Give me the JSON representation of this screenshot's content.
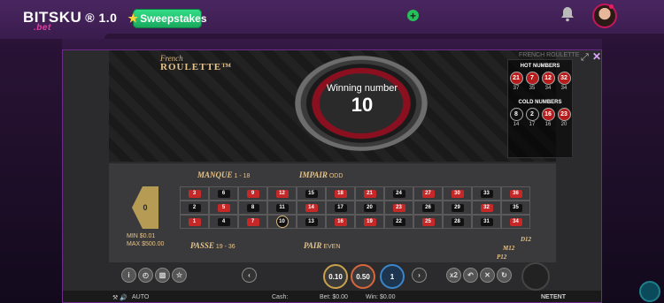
{
  "header": {
    "logo_text": "BITSKU",
    "logo_sub": ".bet",
    "logo_version": "® 1.0",
    "sweep_label": "Sweepstakes"
  },
  "game": {
    "title_line1": "French",
    "title_line2": "ROULETTE™",
    "frame_label": "FRENCH ROULETTE",
    "winning_label": "Winning number",
    "winning_number": "10",
    "hot_label": "HOT NUMBERS",
    "hot": [
      {
        "n": "21",
        "c": "37",
        "color": "red"
      },
      {
        "n": "7",
        "c": "35",
        "color": "red"
      },
      {
        "n": "12",
        "c": "34",
        "color": "red"
      },
      {
        "n": "32",
        "c": "34",
        "color": "red"
      }
    ],
    "cold_label": "COLD NUMBERS",
    "cold": [
      {
        "n": "8",
        "c": "14",
        "color": "black"
      },
      {
        "n": "2",
        "c": "17",
        "color": "black"
      },
      {
        "n": "16",
        "c": "16",
        "color": "red"
      },
      {
        "n": "23",
        "c": "20",
        "color": "red"
      }
    ]
  },
  "table": {
    "manque": "MANQUE",
    "manque_range": "1 - 18",
    "impair": "IMPAIR",
    "impair_sub": "ODD",
    "passe": "PASSE",
    "passe_range": "19 - 36",
    "pair": "PAIR",
    "pair_sub": "EVEN",
    "zero": "0",
    "min": "MIN $0.01",
    "max": "MAX $500.00",
    "d12a": "D12",
    "m12": "M12",
    "p12": "P12",
    "rows": [
      [
        {
          "n": "3",
          "c": "red"
        },
        {
          "n": "6",
          "c": "black"
        },
        {
          "n": "9",
          "c": "red"
        },
        {
          "n": "12",
          "c": "red"
        },
        {
          "n": "15",
          "c": "black"
        },
        {
          "n": "18",
          "c": "red"
        },
        {
          "n": "21",
          "c": "red"
        },
        {
          "n": "24",
          "c": "black"
        },
        {
          "n": "27",
          "c": "red"
        },
        {
          "n": "30",
          "c": "red"
        },
        {
          "n": "33",
          "c": "black"
        },
        {
          "n": "36",
          "c": "red"
        }
      ],
      [
        {
          "n": "2",
          "c": "black"
        },
        {
          "n": "5",
          "c": "red"
        },
        {
          "n": "8",
          "c": "black"
        },
        {
          "n": "11",
          "c": "black"
        },
        {
          "n": "14",
          "c": "red"
        },
        {
          "n": "17",
          "c": "black"
        },
        {
          "n": "20",
          "c": "black"
        },
        {
          "n": "23",
          "c": "red"
        },
        {
          "n": "26",
          "c": "black"
        },
        {
          "n": "29",
          "c": "black"
        },
        {
          "n": "32",
          "c": "red"
        },
        {
          "n": "35",
          "c": "black"
        }
      ],
      [
        {
          "n": "1",
          "c": "red"
        },
        {
          "n": "4",
          "c": "black"
        },
        {
          "n": "7",
          "c": "red"
        },
        {
          "n": "10",
          "c": "black"
        },
        {
          "n": "13",
          "c": "black"
        },
        {
          "n": "16",
          "c": "red"
        },
        {
          "n": "19",
          "c": "red"
        },
        {
          "n": "22",
          "c": "black"
        },
        {
          "n": "25",
          "c": "red"
        },
        {
          "n": "28",
          "c": "black"
        },
        {
          "n": "31",
          "c": "black"
        },
        {
          "n": "34",
          "c": "red"
        }
      ]
    ]
  },
  "chips": [
    "0.10",
    "0.50",
    "1"
  ],
  "controls": {
    "x2": "x2"
  },
  "footer": {
    "auto": "AUTO",
    "cash": "Cash:",
    "bet": "Bet: $0.00",
    "win": "Win: $0.00",
    "brand": "NETENT"
  }
}
